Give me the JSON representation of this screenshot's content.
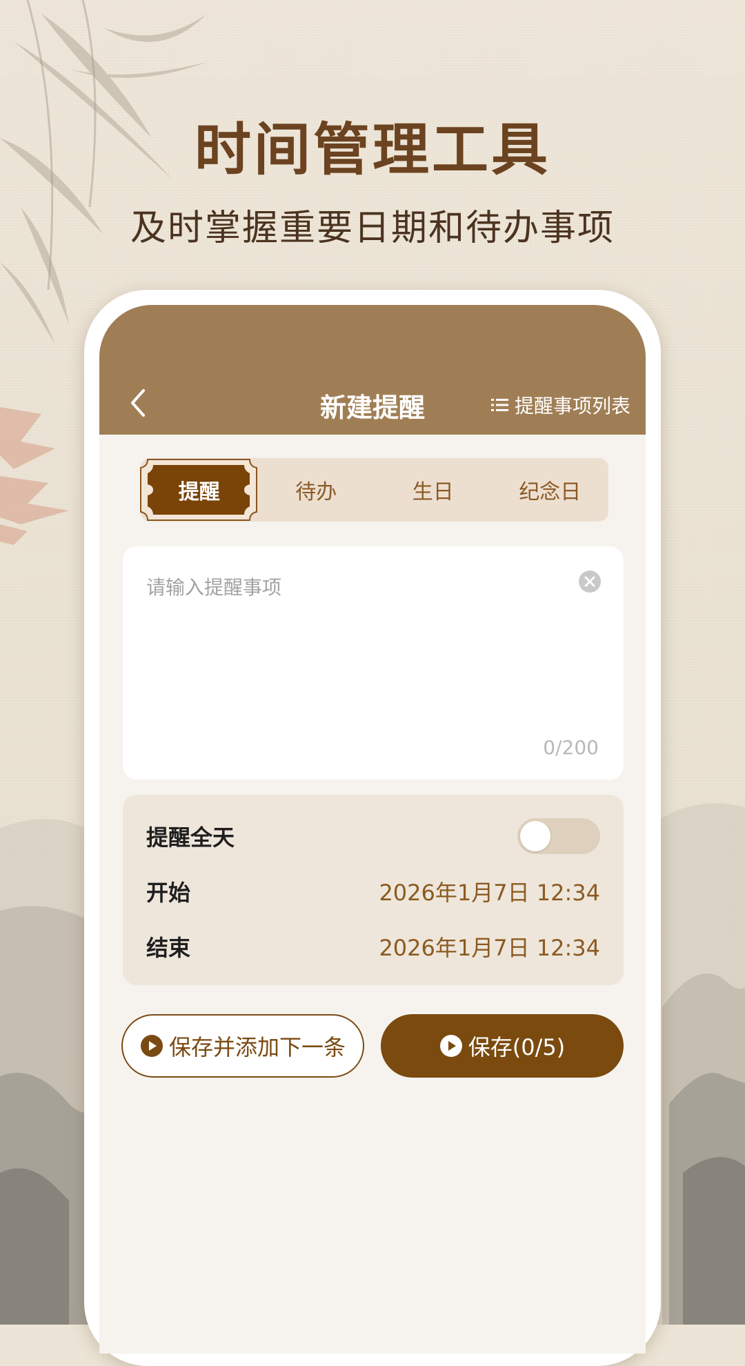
{
  "banner": {
    "title": "时间管理工具",
    "subtitle": "及时掌握重要日期和待办事项"
  },
  "appbar": {
    "title": "新建提醒",
    "list_link": "提醒事项列表"
  },
  "tabs": [
    {
      "label": "提醒",
      "active": true
    },
    {
      "label": "待办",
      "active": false
    },
    {
      "label": "生日",
      "active": false
    },
    {
      "label": "纪念日",
      "active": false
    }
  ],
  "input": {
    "placeholder": "请输入提醒事项",
    "counter": "0/200"
  },
  "settings": {
    "all_day_label": "提醒全天",
    "all_day_on": false,
    "start_label": "开始",
    "start_value": "2026年1月7日 12:34",
    "end_label": "结束",
    "end_value": "2026年1月7日 12:34"
  },
  "buttons": {
    "save_next": "保存并添加下一条",
    "save": "保存(0/5)"
  },
  "colors": {
    "appbar": "#a07e55",
    "accent": "#7a4a0e",
    "title": "#6b4320"
  },
  "icons": [
    "chevron-left-icon",
    "list-icon",
    "clear-icon",
    "play-circle-icon"
  ]
}
